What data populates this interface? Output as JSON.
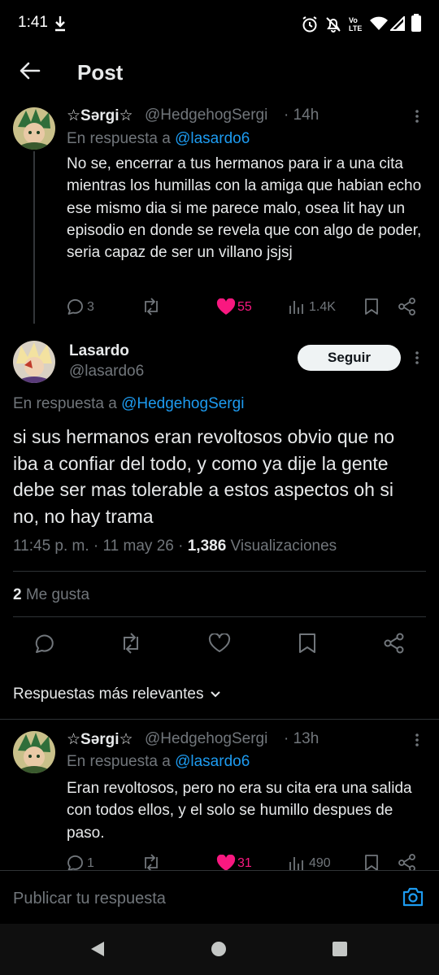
{
  "status_bar": {
    "time": "1:41"
  },
  "header": {
    "title": "Post"
  },
  "parent_tweet": {
    "display_name": "☆Sərgi☆",
    "handle": "@HedgehogSergi",
    "time": "· 14h",
    "reply_prefix": "En respuesta a",
    "reply_to": "@lasardo6",
    "text": "No se, encerrar a tus hermanos para ir a una cita mientras los humillas con la amiga que habian echo ese mismo dia si me parece malo, osea lit hay un episodio en donde se revela que con algo de poder, seria capaz de ser un villano jsjsj",
    "replies": "3",
    "likes": "55",
    "views": "1.4K"
  },
  "main_tweet": {
    "display_name": "Lasardo",
    "handle": "@lasardo6",
    "follow_label": "Seguir",
    "reply_prefix": "En respuesta a",
    "reply_to": "@HedgehogSergi",
    "text": "si sus hermanos eran revoltosos obvio que no iba a confiar del todo, y como ya dije la gente debe ser mas tolerable a estos aspectos oh si no, no hay trama",
    "timestamp": "11:45 p. m. · 11 may 26 · ",
    "views_count": "1,386",
    "views_label": " Visualizaciones",
    "likes_count": "2",
    "likes_label": " Me gusta"
  },
  "sort_label": "Respuestas más relevantes",
  "reply_tweet": {
    "display_name": "☆Sərgi☆",
    "handle": "@HedgehogSergi",
    "time": "· 13h",
    "reply_prefix": "En respuesta a",
    "reply_to": "@lasardo6",
    "text": "Eran revoltosos, pero no era su cita era una salida con todos ellos, y el solo se humillo despues de paso.",
    "replies": "1",
    "likes": "31",
    "views": "490"
  },
  "composer": {
    "placeholder": "Publicar tu respuesta"
  },
  "colors": {
    "accent": "#1d9bf0",
    "like": "#f91880",
    "muted": "#71767b",
    "background": "#000000"
  }
}
